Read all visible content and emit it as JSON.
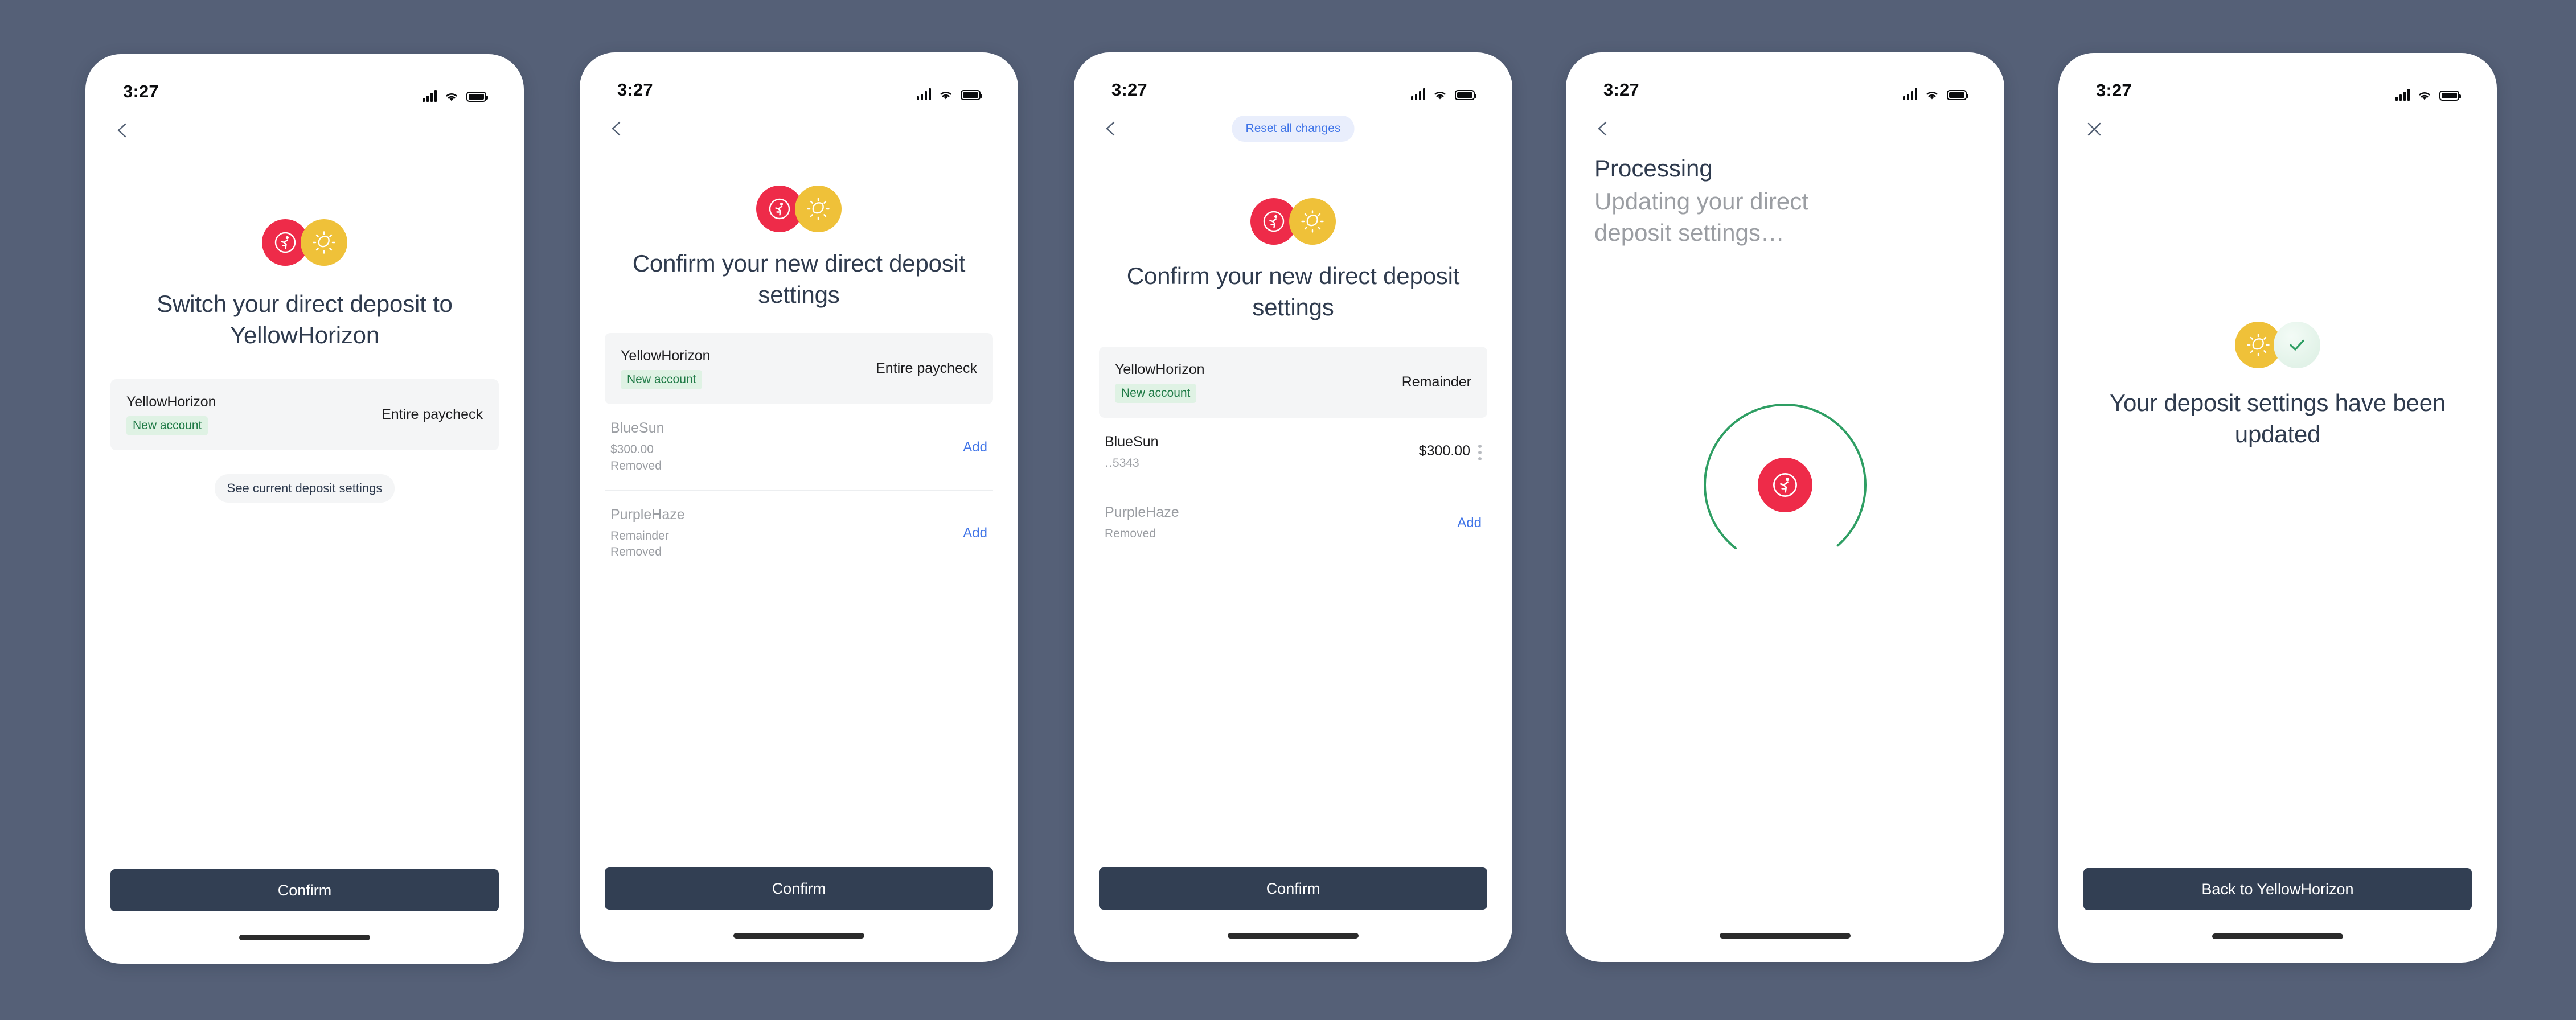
{
  "colors": {
    "background": "#556077",
    "brand_red": "#ee2b49",
    "brand_yellow": "#efc139",
    "success_green": "#2e9e63",
    "link_blue": "#3f74e8",
    "cta_dark": "#323f53",
    "badge_green_text": "#1f7a46",
    "badge_green_bg": "#dff2e4",
    "muted_text": "#9b9ea3"
  },
  "status_bar": {
    "time": "3:27",
    "signal_icon": "cellular-signal-icon",
    "wifi_icon": "wifi-icon",
    "battery_icon": "battery-full-icon"
  },
  "screens": [
    {
      "id": "switch-deposit",
      "nav": {
        "back_icon": "back-arrow-icon"
      },
      "logos": [
        "runner-logo-red",
        "sun-logo-yellow"
      ],
      "headline": "Switch your direct deposit to YellowHorizon",
      "account_card": {
        "name": "YellowHorizon",
        "badge": "New account",
        "amount": "Entire paycheck"
      },
      "secondary_link": "See current deposit settings",
      "cta": "Confirm"
    },
    {
      "id": "confirm-settings-removed",
      "nav": {
        "back_icon": "back-arrow-icon"
      },
      "logos": [
        "runner-logo-red",
        "sun-logo-yellow"
      ],
      "headline": "Confirm your new direct deposit settings",
      "account_card": {
        "name": "YellowHorizon",
        "badge": "New account",
        "amount": "Entire paycheck"
      },
      "rows": [
        {
          "name": "BlueSun",
          "sub": "$300.00\nRemoved",
          "action": "Add",
          "muted": true
        },
        {
          "name": "PurpleHaze",
          "sub": "Remainder\nRemoved",
          "action": "Add",
          "muted": true
        }
      ],
      "cta": "Confirm"
    },
    {
      "id": "confirm-settings-edit",
      "nav": {
        "back_icon": "back-arrow-icon",
        "reset_button": "Reset all changes"
      },
      "logos": [
        "runner-logo-red",
        "sun-logo-yellow"
      ],
      "headline": "Confirm your new direct deposit settings",
      "account_card": {
        "name": "YellowHorizon",
        "badge": "New account",
        "amount": "Remainder"
      },
      "rows": [
        {
          "name": "BlueSun",
          "sub": "‥5343",
          "amount": "$300.00",
          "menu_icon": "kebab-menu-icon",
          "muted": false
        },
        {
          "name": "PurpleHaze",
          "sub": "Removed",
          "action": "Add",
          "muted": true
        }
      ],
      "cta": "Confirm"
    },
    {
      "id": "processing",
      "nav": {
        "back_icon": "back-arrow-icon"
      },
      "title": "Processing",
      "subtitle": "Updating your direct deposit settings…",
      "spinner": {
        "icon": "runner-logo-red",
        "arc_color": "#2e9e63",
        "progress_percent": 78
      }
    },
    {
      "id": "success",
      "nav": {
        "close_icon": "close-x-icon"
      },
      "logos": [
        "sun-logo-yellow",
        "check-logo-green"
      ],
      "headline": "Your deposit settings have been updated",
      "cta": "Back to YellowHorizon"
    }
  ]
}
